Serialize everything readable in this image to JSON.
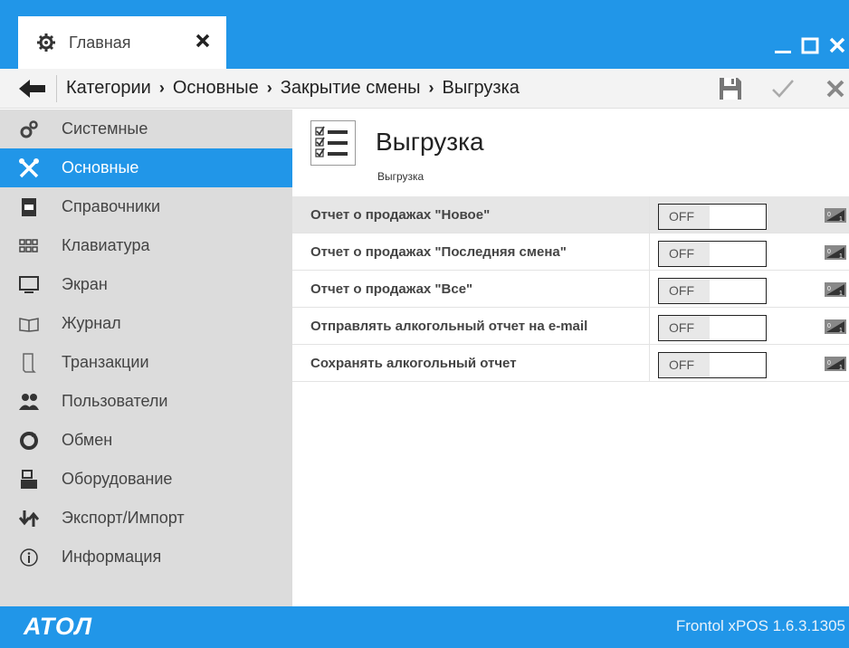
{
  "window": {
    "tab_label": "Главная",
    "tab_icon": "gear-icon",
    "controls": [
      "minimize-icon",
      "maximize-icon",
      "close-icon"
    ]
  },
  "toolbar": {
    "breadcrumbs": [
      "Категории",
      "Основные",
      "Закрытие смены",
      "Выгрузка"
    ],
    "separator": "›",
    "actions": [
      "save-icon",
      "apply-check-icon",
      "cancel-icon"
    ]
  },
  "sidebar": {
    "items": [
      {
        "label": "Системные",
        "icon": "gears-icon",
        "active": false
      },
      {
        "label": "Основные",
        "icon": "tools-icon",
        "active": true
      },
      {
        "label": "Справочники",
        "icon": "book-icon",
        "active": false
      },
      {
        "label": "Клавиатура",
        "icon": "keyboard-icon",
        "active": false
      },
      {
        "label": "Экран",
        "icon": "monitor-icon",
        "active": false
      },
      {
        "label": "Журнал",
        "icon": "journal-icon",
        "active": false
      },
      {
        "label": "Транзакции",
        "icon": "receipt-icon",
        "active": false
      },
      {
        "label": "Пользователи",
        "icon": "users-icon",
        "active": false
      },
      {
        "label": "Обмен",
        "icon": "sync-icon",
        "active": false
      },
      {
        "label": "Оборудование",
        "icon": "cash-register-icon",
        "active": false
      },
      {
        "label": "Экспорт/Импорт",
        "icon": "export-import-icon",
        "active": false
      },
      {
        "label": "Информация",
        "icon": "info-icon",
        "active": false
      }
    ]
  },
  "main": {
    "title": "Выгрузка",
    "subtitle": "Выгрузка",
    "settings": [
      {
        "label": "Отчет о продажах \"Новое\"",
        "value": "OFF"
      },
      {
        "label": "Отчет о продажах \"Последняя смена\"",
        "value": "OFF"
      },
      {
        "label": "Отчет о продажах \"Все\"",
        "value": "OFF"
      },
      {
        "label": "Отправлять алкогольный отчет на e-mail",
        "value": "OFF"
      },
      {
        "label": "Сохранять алкогольный отчет",
        "value": "OFF"
      }
    ]
  },
  "footer": {
    "logo": "АТОЛ",
    "version": "Frontol xPOS 1.6.3.1305"
  },
  "colors": {
    "accent": "#2196e8",
    "sidebar_bg": "#dcdcdc",
    "toolbar_bg": "#f3f3f3"
  }
}
